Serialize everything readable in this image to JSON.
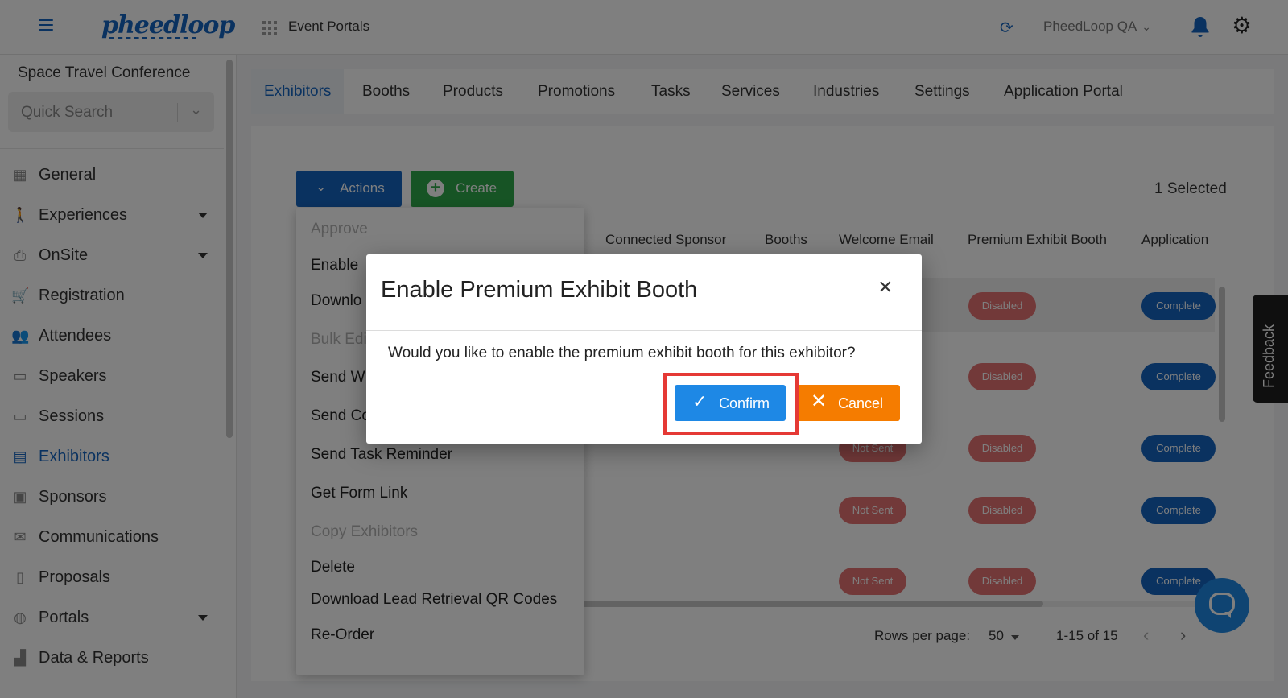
{
  "header": {
    "logo_text": "pheedloop",
    "portal_title": "Event Portals",
    "org_name": "PheedLoop QA",
    "icons": [
      "menu-icon",
      "apps-grid-icon",
      "refresh-icon",
      "chevron-down-icon",
      "bell-icon",
      "gear-icon"
    ]
  },
  "sidebar": {
    "event_name": "Space Travel Conference",
    "search_placeholder": "Quick Search",
    "items": [
      {
        "label": "General",
        "icon": "grid-icon"
      },
      {
        "label": "Experiences",
        "icon": "person-icon"
      },
      {
        "label": "OnSite",
        "icon": "printer-icon"
      },
      {
        "label": "Registration",
        "icon": "cart-icon"
      },
      {
        "label": "Attendees",
        "icon": "people-icon"
      },
      {
        "label": "Speakers",
        "icon": "presenter-icon"
      },
      {
        "label": "Sessions",
        "icon": "laptop-icon"
      },
      {
        "label": "Exhibitors",
        "icon": "store-icon"
      },
      {
        "label": "Sponsors",
        "icon": "badge-icon"
      },
      {
        "label": "Communications",
        "icon": "mail-icon"
      },
      {
        "label": "Proposals",
        "icon": "document-icon"
      },
      {
        "label": "Portals",
        "icon": "globe-icon"
      },
      {
        "label": "Data & Reports",
        "icon": "chart-icon"
      }
    ],
    "active_item": "Exhibitors"
  },
  "tabs": [
    "Exhibitors",
    "Booths",
    "Products",
    "Promotions",
    "Tasks",
    "Services",
    "Industries",
    "Settings",
    "Application Portal"
  ],
  "active_tab": "Exhibitors",
  "toolbar": {
    "actions_label": "Actions",
    "create_label": "Create",
    "selected_text": "1 Selected"
  },
  "actions_menu": [
    {
      "label": "Approve",
      "disabled": true
    },
    {
      "label": "Enable",
      "disabled": false
    },
    {
      "label": "Downlo",
      "disabled": false
    },
    {
      "label": "Bulk Edi",
      "disabled": true
    },
    {
      "label": "Send W",
      "disabled": false
    },
    {
      "label": "Send Co",
      "disabled": false
    },
    {
      "label": "Send Task Reminder",
      "disabled": false
    },
    {
      "label": "Get Form Link",
      "disabled": false
    },
    {
      "label": "Copy Exhibitors",
      "disabled": true
    },
    {
      "label": "Delete",
      "disabled": false
    },
    {
      "label": "Download Lead Retrieval QR Codes",
      "disabled": false
    },
    {
      "label": "Re-Order",
      "disabled": false
    }
  ],
  "table": {
    "columns": [
      "Connected Sponsor",
      "Booths",
      "Welcome Email",
      "Premium Exhibit Booth",
      "Application"
    ],
    "rows": [
      {
        "welcome_email": "",
        "premium_booth": "Disabled",
        "application": "Complete"
      },
      {
        "welcome_email": "",
        "premium_booth": "Disabled",
        "application": "Complete"
      },
      {
        "welcome_email": "Not Sent",
        "premium_booth": "Disabled",
        "application": "Complete"
      },
      {
        "welcome_email": "Not Sent",
        "premium_booth": "Disabled",
        "application": "Complete"
      },
      {
        "welcome_email": "Not Sent",
        "premium_booth": "Disabled",
        "application": "Complete"
      }
    ]
  },
  "pagination": {
    "rows_per_page_label": "Rows per page:",
    "rows_per_page_value": "50",
    "range_text": "1-15 of 15"
  },
  "feedback_label": "Feedback",
  "modal": {
    "title": "Enable Premium Exhibit Booth",
    "body": "Would you like to enable the premium exhibit booth for this exhibitor?",
    "confirm_label": "Confirm",
    "cancel_label": "Cancel"
  },
  "colors": {
    "primary": "#1565c0",
    "create_green": "#2ea84a",
    "confirm_blue": "#1e88e5",
    "cancel_orange": "#f57c00",
    "pill_red": "#e57373",
    "highlight_red": "#e53935"
  }
}
